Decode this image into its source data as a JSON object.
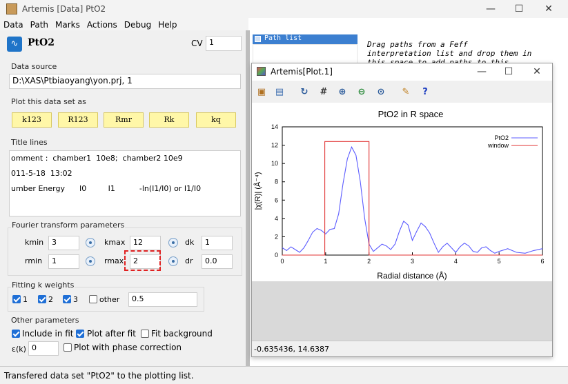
{
  "window": {
    "title": "Artemis [Data] PtO2"
  },
  "menu": [
    "Data",
    "Path",
    "Marks",
    "Actions",
    "Debug",
    "Help"
  ],
  "dataset": {
    "name": "PtO2",
    "cv_label": "CV",
    "cv_value": "1"
  },
  "data_source": {
    "label": "Data source",
    "value": "D:\\XAS\\Ptbiaoyang\\yon.prj, 1"
  },
  "plot_as": {
    "label": "Plot this data set as",
    "buttons": [
      "k123",
      "R123",
      "Rmr",
      "Rk",
      "kq"
    ]
  },
  "title_lines": {
    "label": "Title lines",
    "lines": [
      "omment :  chamber1  10e8;  chamber2 10e9",
      "011-5-18  13:02",
      "umber Energy      I0         I1          -ln(I1/I0) or I1/I0"
    ]
  },
  "fourier": {
    "label": "Fourier transform parameters",
    "kmin_label": "kmin",
    "kmin": "3",
    "kmax_label": "kmax",
    "kmax": "12",
    "dk_label": "dk",
    "dk": "1",
    "rmin_label": "rmin",
    "rmin": "1",
    "rmax_label": "rmax",
    "rmax": "2",
    "dr_label": "dr",
    "dr": "0.0"
  },
  "fitting_k": {
    "label": "Fitting k weights",
    "k1": "1",
    "k2": "2",
    "k3": "3",
    "other_label": "other",
    "other_value": "0.5",
    "k1_checked": true,
    "k2_checked": true,
    "k3_checked": true,
    "other_checked": false
  },
  "other_params": {
    "label": "Other parameters",
    "include_label": "Include in fit",
    "include_checked": true,
    "plot_after_label": "Plot after fit",
    "plot_after_checked": true,
    "fit_bg_label": "Fit background",
    "fit_bg_checked": false,
    "epsilon_label": "ε(k)",
    "epsilon_value": "0",
    "phase_label": "Plot with phase correction",
    "phase_checked": false
  },
  "path_list": {
    "header": "Path list",
    "hint": "Drag paths from a Feff interpretation list and drop them in this space to add paths to this"
  },
  "plot_window": {
    "title": "Artemis[Plot.1]",
    "coords": "-0.635436,  14.6387"
  },
  "toolbar_icons": [
    "clipboard-icon",
    "save-image-icon",
    "refresh-icon",
    "grid-icon",
    "zoom-in-icon",
    "zoom-out-icon",
    "zoom-reset-icon",
    "wrench-icon",
    "help-icon"
  ],
  "chart_data": {
    "type": "line",
    "title": "PtO2 in R space",
    "xlabel": "Radial distance  (Å)",
    "ylabel": "|χ(R)|  (Å⁻⁴)",
    "xlim": [
      0,
      6
    ],
    "ylim": [
      0,
      14
    ],
    "xticks": [
      "0",
      "1",
      "2",
      "3",
      "4",
      "5",
      "6"
    ],
    "yticks": [
      "0",
      "2",
      "4",
      "6",
      "8",
      "10",
      "12",
      "14"
    ],
    "legend_position": "top-right",
    "series": [
      {
        "name": "PtO2",
        "color": "#5b5bff",
        "x": [
          0,
          0.1,
          0.2,
          0.3,
          0.4,
          0.5,
          0.6,
          0.7,
          0.8,
          0.9,
          1.0,
          1.1,
          1.2,
          1.3,
          1.4,
          1.5,
          1.6,
          1.7,
          1.8,
          1.9,
          2.0,
          2.1,
          2.2,
          2.3,
          2.4,
          2.5,
          2.6,
          2.7,
          2.8,
          2.9,
          3.0,
          3.1,
          3.2,
          3.3,
          3.4,
          3.5,
          3.6,
          3.7,
          3.8,
          3.9,
          4.0,
          4.1,
          4.2,
          4.3,
          4.4,
          4.5,
          4.6,
          4.7,
          4.8,
          4.9,
          5.0,
          5.2,
          5.4,
          5.6,
          5.8,
          6.0
        ],
        "y": [
          0.8,
          0.5,
          0.9,
          0.6,
          0.3,
          0.8,
          1.6,
          2.5,
          2.9,
          2.7,
          2.3,
          2.8,
          2.9,
          4.5,
          7.8,
          10.5,
          11.8,
          10.9,
          8.0,
          4.0,
          1.2,
          0.4,
          0.8,
          1.2,
          1.0,
          0.6,
          1.2,
          2.6,
          3.7,
          3.3,
          1.6,
          2.6,
          3.5,
          3.1,
          2.4,
          1.3,
          0.3,
          0.9,
          1.3,
          0.8,
          0.3,
          0.9,
          1.3,
          1.0,
          0.4,
          0.3,
          0.8,
          0.9,
          0.5,
          0.2,
          0.4,
          0.7,
          0.3,
          0.2,
          0.5,
          0.7
        ]
      },
      {
        "name": "window",
        "color": "#e03030",
        "x": [
          0,
          0.98,
          0.98,
          2.0,
          2.0,
          6.0
        ],
        "y": [
          0,
          0,
          12.4,
          12.4,
          0,
          0
        ]
      }
    ]
  },
  "status": {
    "message": "Transfered data set \"PtO2\" to the plotting list."
  }
}
